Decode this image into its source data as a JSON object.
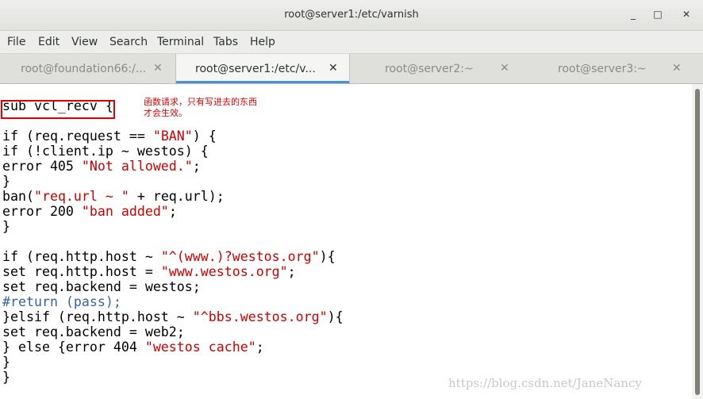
{
  "window": {
    "title": "root@server1:/etc/varnish",
    "minimize_icon": "minimize-icon",
    "maximize_icon": "maximize-icon",
    "close_icon": "close-icon",
    "minimize": "_",
    "maximize": "□",
    "close": "✕"
  },
  "menu": [
    "File",
    "Edit",
    "View",
    "Search",
    "Terminal",
    "Tabs",
    "Help"
  ],
  "tabs": [
    {
      "label": "root@foundation66:/...",
      "close": "✕",
      "active": false
    },
    {
      "label": "root@server1:/etc/v...",
      "close": "✕",
      "active": true
    },
    {
      "label": "root@server2:~",
      "close": "✕",
      "active": false
    },
    {
      "label": "root@server3:~",
      "close": "✕",
      "active": false
    }
  ],
  "annotation": {
    "line1": "函数请求，只有写进去的东西",
    "line2": "才会生效。",
    "box_color": "#e00000"
  },
  "code_lines": [
    [
      {
        "t": "sub vcl_recv {"
      }
    ],
    [
      {
        "t": ""
      }
    ],
    [
      {
        "t": "if (req.request == "
      },
      {
        "t": "\"BAN\"",
        "c": "str"
      },
      {
        "t": ") {"
      }
    ],
    [
      {
        "t": "if (!client.ip ~ westos) {"
      }
    ],
    [
      {
        "t": "error 405 "
      },
      {
        "t": "\"Not allowed.\"",
        "c": "str"
      },
      {
        "t": ";"
      }
    ],
    [
      {
        "t": "}"
      }
    ],
    [
      {
        "t": "ban("
      },
      {
        "t": "\"req.url ~ \"",
        "c": "str"
      },
      {
        "t": " + req.url);"
      }
    ],
    [
      {
        "t": "error 200 "
      },
      {
        "t": "\"ban added\"",
        "c": "str"
      },
      {
        "t": ";"
      }
    ],
    [
      {
        "t": "}"
      }
    ],
    [
      {
        "t": ""
      }
    ],
    [
      {
        "t": "if (req.http.host ~ "
      },
      {
        "t": "\"^(www.)?westos.org\"",
        "c": "str"
      },
      {
        "t": "){"
      }
    ],
    [
      {
        "t": "set req.http.host = "
      },
      {
        "t": "\"www.westos.org\"",
        "c": "str"
      },
      {
        "t": ";"
      }
    ],
    [
      {
        "t": "set req.backend = westos;"
      }
    ],
    [
      {
        "t": "#return (pass);",
        "c": "cmt"
      }
    ],
    [
      {
        "t": "}elsif (req.http.host ~ "
      },
      {
        "t": "\"^bbs.westos.org\"",
        "c": "str"
      },
      {
        "t": "){"
      }
    ],
    [
      {
        "t": "set req.backend = web2;"
      }
    ],
    [
      {
        "t": "} else {error 404 "
      },
      {
        "t": "\"westos cache\"",
        "c": "str"
      },
      {
        "t": ";"
      }
    ],
    [
      {
        "t": "}"
      }
    ],
    [
      {
        "t": "}"
      }
    ]
  ],
  "colors": {
    "string": "#cc0000",
    "comment": "#3465a4",
    "tab_underline": "#4a90d9"
  },
  "watermark": "https://blog.csdn.net/JaneNancy"
}
